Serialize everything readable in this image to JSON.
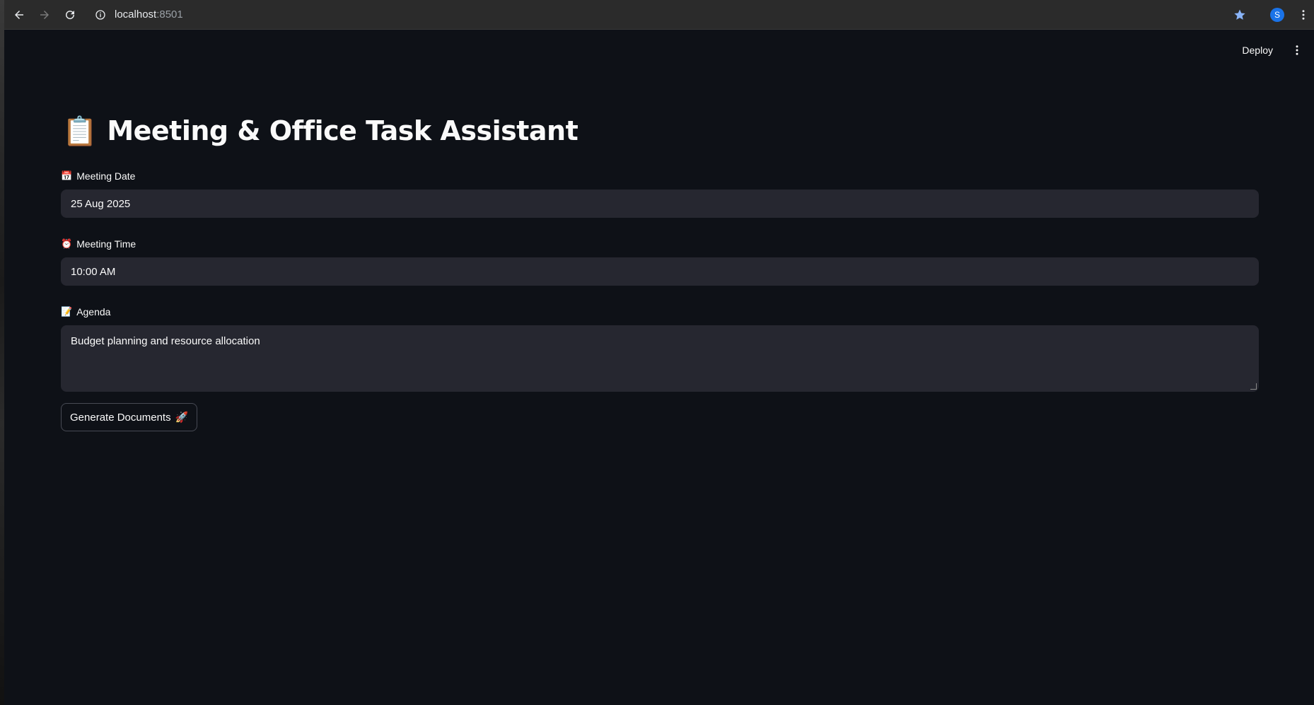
{
  "browser": {
    "url_host": "localhost",
    "url_port": ":8501",
    "profile_initial": "S"
  },
  "app_header": {
    "deploy_label": "Deploy"
  },
  "page": {
    "title_emoji": "📋",
    "title": "Meeting & Office Task Assistant"
  },
  "form": {
    "date": {
      "icon": "📅",
      "label": "Meeting Date",
      "value": "25 Aug 2025"
    },
    "time": {
      "icon": "⏰",
      "label": "Meeting Time",
      "value": "10:00 AM"
    },
    "agenda": {
      "icon": "📝",
      "label": "Agenda",
      "value": "Budget planning and resource allocation"
    },
    "submit": {
      "label": "Generate Documents",
      "emoji": "🚀"
    }
  },
  "colors": {
    "background": "#0e1117",
    "input_bg": "#262730",
    "browser_bar": "#2b2b2b",
    "accent_profile": "#1a73e8"
  }
}
